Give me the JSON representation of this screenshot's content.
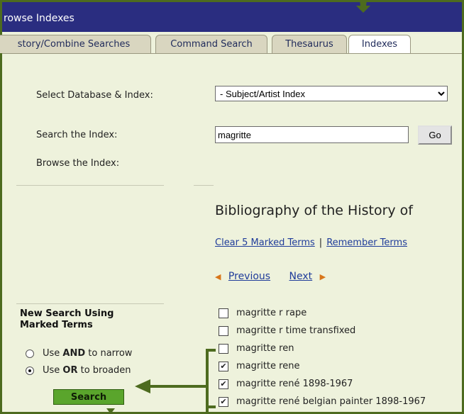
{
  "title": "rowse Indexes",
  "tabs": [
    {
      "label": "story/Combine Searches",
      "active": false
    },
    {
      "label": "Command Search",
      "active": false
    },
    {
      "label": "Thesaurus",
      "active": false
    },
    {
      "label": "Indexes",
      "active": true
    }
  ],
  "form": {
    "db_label": "Select Database & Index:",
    "db_value": "- Subject/Artist Index",
    "search_label": "Search the Index:",
    "search_value": "magritte",
    "go_label": "Go",
    "browse_label": "Browse the Index:"
  },
  "results": {
    "heading": "Bibliography of the History of ",
    "clear_link": "Clear 5 Marked Terms",
    "separator": "|",
    "remember_link": "Remember Terms",
    "previous": "Previous",
    "next": "Next",
    "terms": [
      {
        "label": "magritte r rape",
        "checked": false
      },
      {
        "label": "magritte r time transfixed",
        "checked": false
      },
      {
        "label": "magritte ren",
        "checked": false
      },
      {
        "label": "magritte rene",
        "checked": true
      },
      {
        "label": "magritte rené 1898-1967",
        "checked": true
      },
      {
        "label": "magritte rené belgian painter 1898-1967",
        "checked": true
      }
    ]
  },
  "sidebar": {
    "title_line1": "New Search Using",
    "title_line2": "Marked Terms",
    "and_prefix": "Use ",
    "and_bold": "AND",
    "and_suffix": " to narrow",
    "or_prefix": "Use ",
    "or_bold": "OR",
    "or_suffix": " to broaden",
    "selected_operator": "OR",
    "search_button": "Search"
  },
  "colors": {
    "titlebar": "#2a2d80",
    "frame": "#4d6b1f",
    "panel": "#eef2dc",
    "link": "#1f3c9a",
    "pager_arrow": "#d8761a",
    "search_button": "#5aa52c",
    "annotation": "#4d6b1f"
  }
}
